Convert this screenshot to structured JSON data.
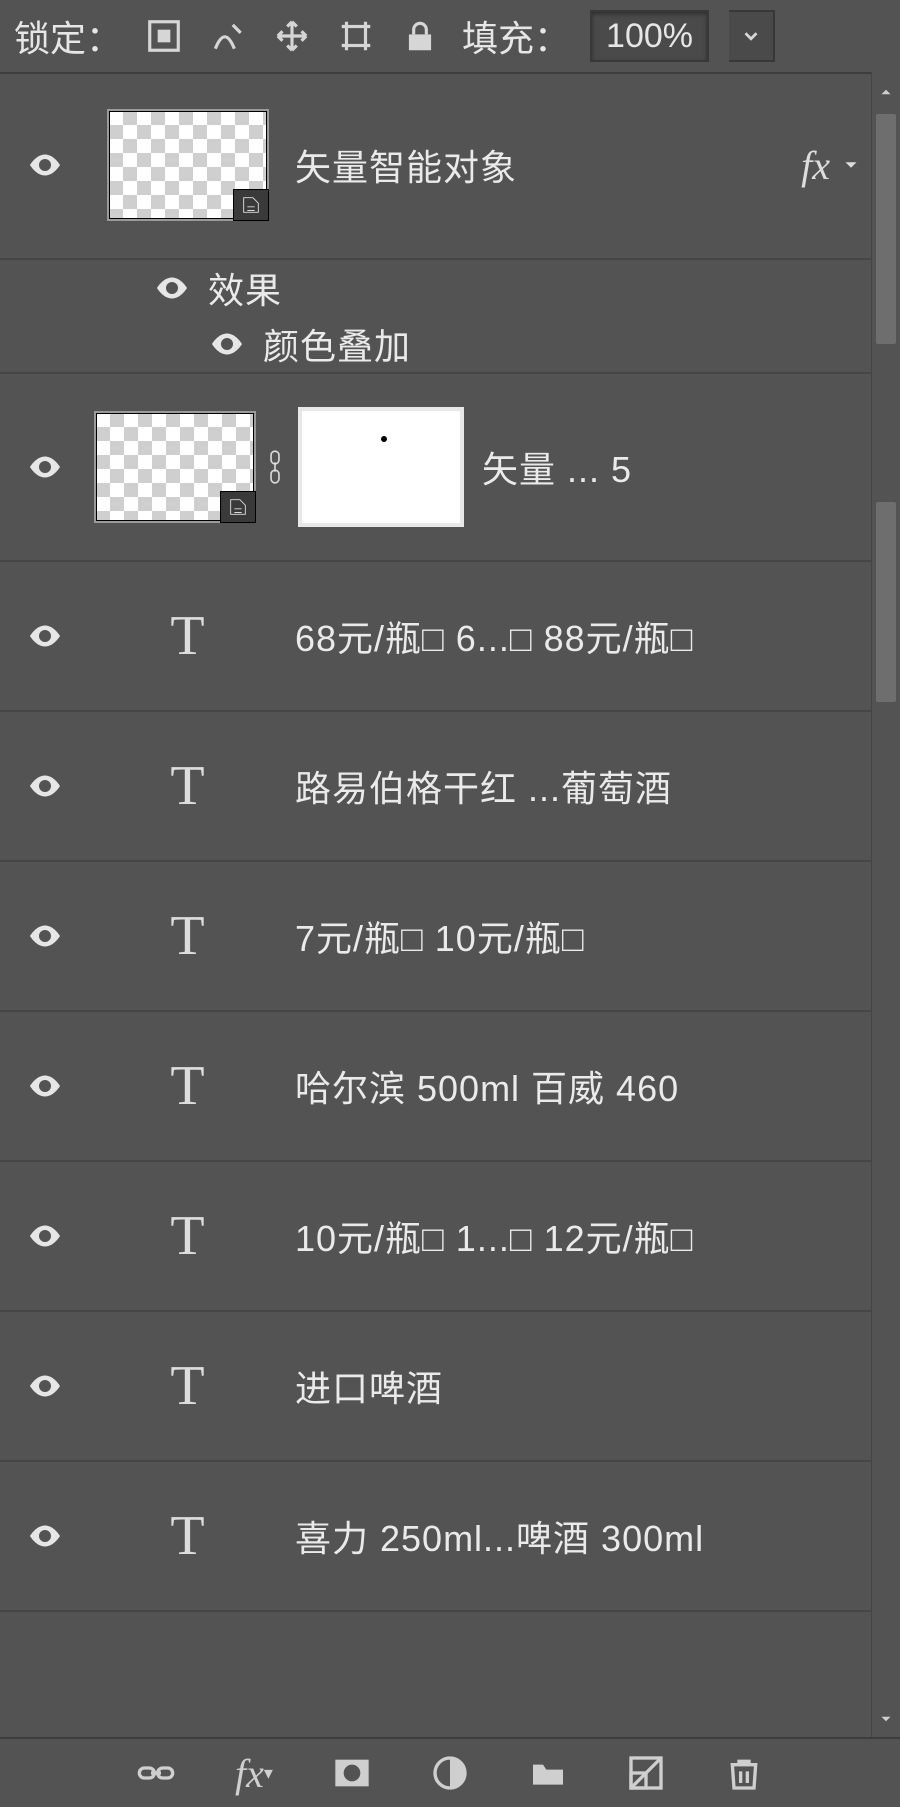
{
  "lockbar": {
    "lock_label": "锁定：",
    "fill_label": "填充：",
    "fill_value": "100%"
  },
  "layers": [
    {
      "kind": "thumb-so",
      "name": "矢量智能对象",
      "fx": true
    },
    {
      "kind": "sub",
      "name": "效果"
    },
    {
      "kind": "sub2",
      "name": "颜色叠加"
    },
    {
      "kind": "thumb-mask",
      "name": "矢量 ... 5"
    },
    {
      "kind": "text",
      "name": "68元/瓶□ 6...□ 88元/瓶□"
    },
    {
      "kind": "text",
      "name": "路易伯格干红 ...葡萄酒"
    },
    {
      "kind": "text",
      "name": "7元/瓶□ 10元/瓶□"
    },
    {
      "kind": "text",
      "name": "哈尔滨 500ml 百威 460"
    },
    {
      "kind": "text",
      "name": "10元/瓶□ 1...□ 12元/瓶□"
    },
    {
      "kind": "text",
      "name": "进口啤酒"
    },
    {
      "kind": "text",
      "name": "喜力 250ml...啤酒 300ml"
    }
  ]
}
